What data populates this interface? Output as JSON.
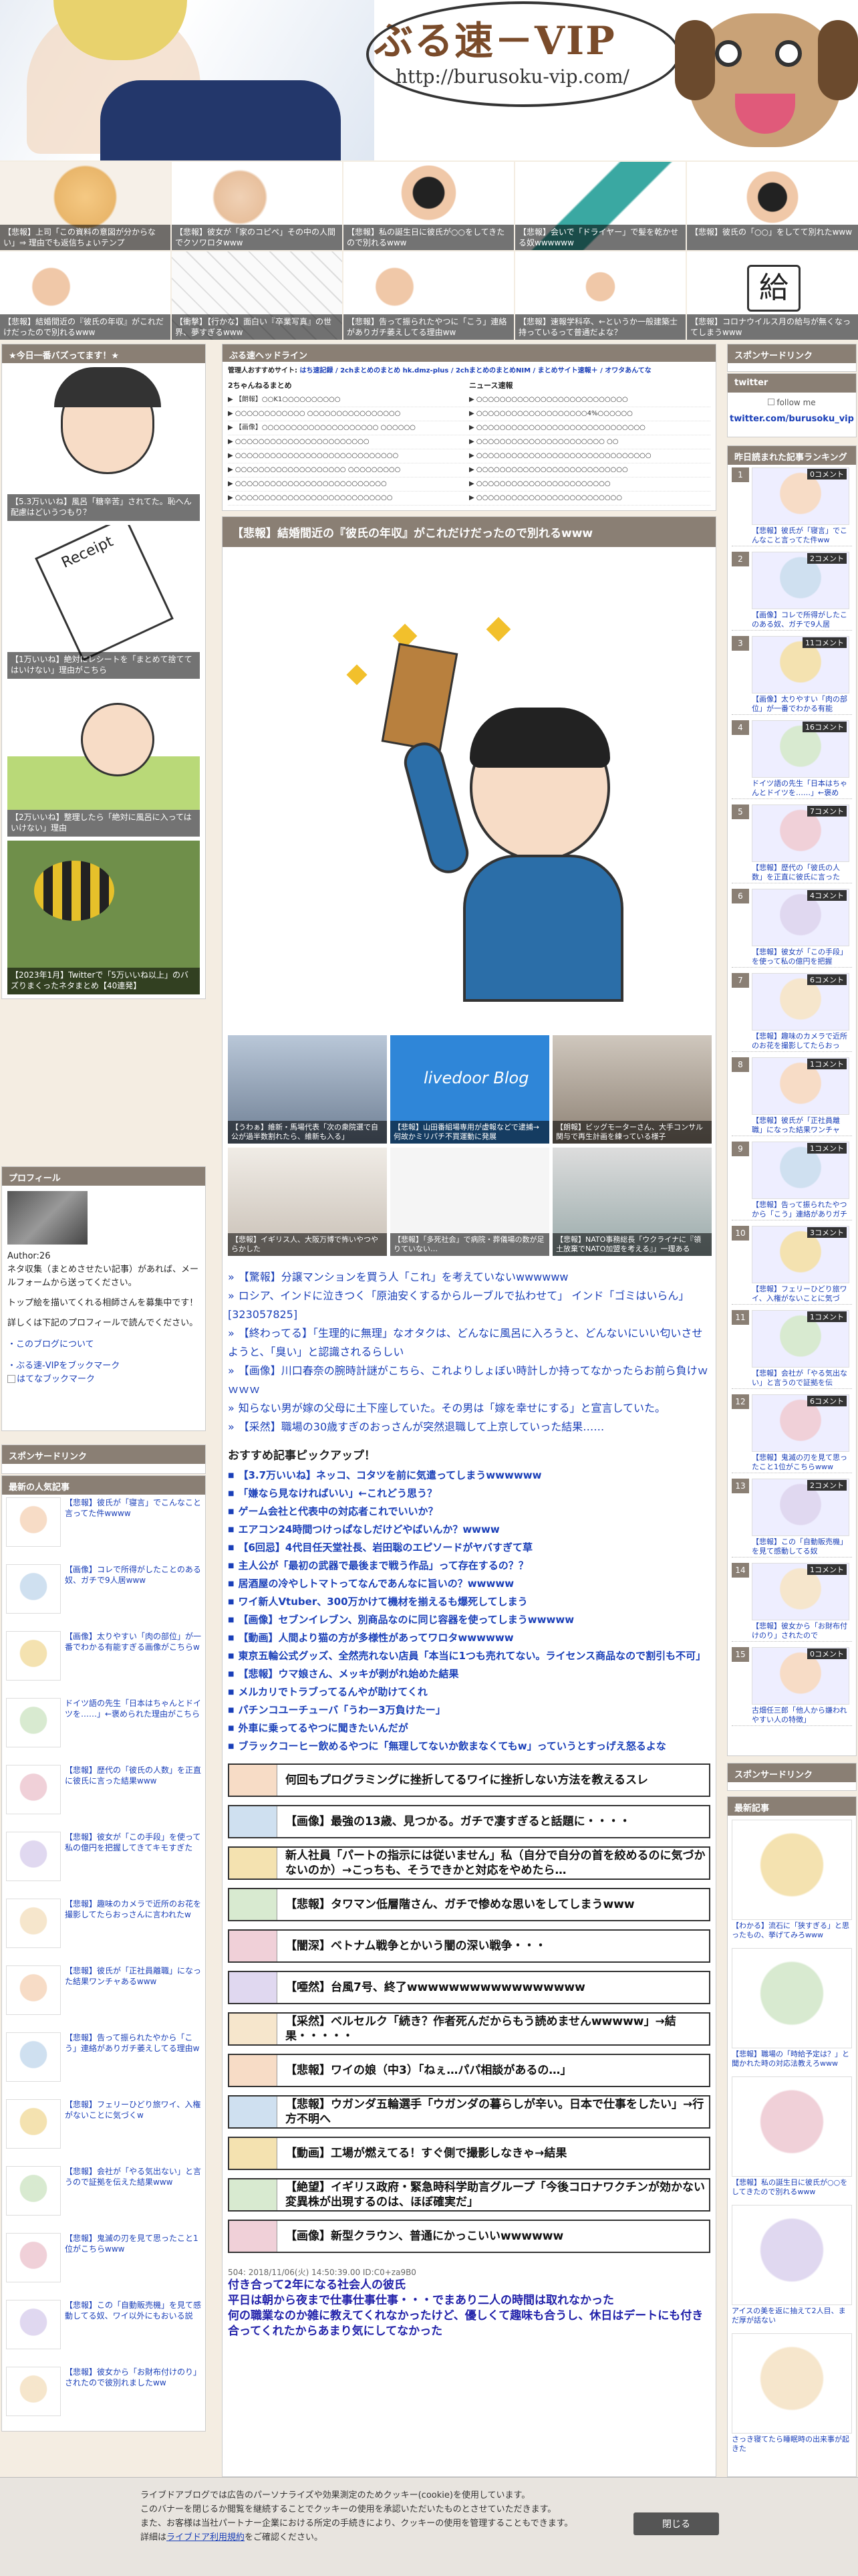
{
  "site": {
    "title": "ぶる速－VIP",
    "url": "http://burusoku-vip.com/"
  },
  "top_articles": [
    "【悲報】上司「この資料の意図が分からない」⇒ 理由でも返信ちょいテンプ",
    "【悲報】彼女が「家のコピペ」その中の人間でクソワロタwww",
    "【悲報】私の誕生日に彼氏が○○をしてきたので別れるwww",
    "【悲報】会いで「ドライヤー」で髪を乾かせる奴wwwwww",
    "【悲報】彼氏の「○○」をしてて別れたwww",
    "【悲報】結婚間近の『彼氏の年収』がこれだけだったので別れるwww",
    "【衝撃】【行かな】面白い『卒業写真』の世界、夢すぎるwww",
    "【悲報】告って振られたやつに「こう」連絡がありガチ萎えしてる理由ww",
    "【悲報】速報学科卒、←というか一般建築士持っているって普通だよな？",
    "【悲報】コロナウイルス月の給与が無くなってしまうwww"
  ],
  "left_col": {
    "head": "★今日一番バズってます！★",
    "items": [
      "【5.3万いいね】風呂「糖辛苦」されてた。恥へん配慮はどいうつもり？",
      "【1万いいね】絶対にレシートを「まとめて捨ててはいけない」理由がこちら",
      "【2万いいね】整理したら「絶対に風呂に入ってはいけない」理由",
      "【2023年1月】Twitterで「5万いいね以上」のバズりまくったネタまとめ【40連発】"
    ],
    "profile_head": "プロフィール",
    "author": "Author:26",
    "profile_text1": "ネタ収集（まとめさせたい記事）があれば、メールフォームから送ってください。",
    "profile_text2": "トップ絵を描いてくれる相師さんを募集中です！",
    "profile_text3": "詳しくは下記のプロフィールで読んでください。",
    "profile_link1": "このブログについて",
    "profile_link2": "ぶる速-VIPをブックマーク",
    "profile_link3": "はてなブックマーク",
    "sponsor_head": "スポンサードリンク",
    "popular_head": "最新の人気記事",
    "popular": [
      "【悲報】彼氏が「寝言」でこんなこと言ってた件wwww",
      "【画像】コレで所得がしたことのある奴、ガチで9人居www",
      "【画像】太りやすい「肉の部位」が一番でわかる有能すぎる画像がこちらw",
      "ドイツ語の先生「日本はちゃんとドイツを……」←褒められた理由がこちら",
      "【悲報】歴代の「彼氏の人数」を正直に彼氏に言った結果www",
      "【悲報】彼女が「この手段」を使って私の億円を把握してきてキモすぎた",
      "【悲報】趣味のカメラで近所のお花を撮影してたらおっさんに言われたw",
      "【悲報】彼氏が「正社員離職」になった結果ワンチャあるwww",
      "【悲報】告って振られたやから「こう」連絡がありガチ萎えしてる理由w",
      "【悲報】フェリーひどり旅ワイ、入権がないことに気づくw",
      "【悲報】会社が「やる気出ない」と言うので証拠を伝えた結果www",
      "【悲報】鬼滅の刃を見て思ったこと1位がこちらwww",
      "【悲報】この「自動販売機」を見て感動してる奴、ワイ以外にもおいる説",
      "【悲報】彼女から「お財布付けのり」されたので彼別れましたww"
    ]
  },
  "center": {
    "head": "ぶる速ヘッドライン",
    "antenna_label": "管理人おすすめサイト:",
    "antenna_links": "はち速記録 / 2chまとめのまとめ hk.dmz-plus / 2chまとめのまとめNIM / まとめサイト速報＋ / オワタあんてな",
    "antenna_left_title": "2ちゃんねるまとめ",
    "antenna_right_title": "ニュース速報",
    "antenna_left": [
      "▶ 【朗報】○○K1○○○○○○○○○○",
      "▶ ○○○○○○○○○○○○ ○○○○○○○○○○○○○○○○",
      "▶ 【画像】○○○○○○○○○○○○○○○○○○○○ ○○○○○○",
      "▶ ○○○○○○○○○○○○○○○○○○○○○○○",
      "▶ ○○○○○○○○○○○○○○○○○○○○○○○○○○○○",
      "▶ ○○○○○○○○○○○○○○○○○○○ ○○○○○○○○○",
      "▶ ○○○○○○○○○○○○○○○○○○○○○○○○○○",
      "▶ ○○○○○○○○○○○○○○○○○○○○○○○○○○○"
    ],
    "antenna_right": [
      "▶ ○○○○○○○○○○○○○○○○○○○○○○○○○○",
      "▶ ○○○○○○○○○○○○○○○○○○○4%○○○○○○",
      "▶ ○○○○○○○○○○○○○○○○○○○○○○○○○○○○○",
      "▶ ○○○○○○○○○○○○○○○○○○○○○○ ○○",
      "▶ ○○○○○○○○○○○○○○○○○○○○○○○○○○○○○○",
      "▶ ○○○○○○○○○○○○○○○○○○○○○○○○○○",
      "▶ ○○○○○○○○○○○○○○○○○○○○○○○",
      "▶ ○○○○○○○○○○○○○○○○○○○○○○○○○"
    ],
    "article_title": "【悲報】結婚間近の『彼氏の年収』がこれだけだったので別れるwww",
    "related": [
      "【うわぁ】維新・馬場代表「次の衆院選で自公が過半数割れたら、維新も入る」",
      "【悲報】山田番組場専用が虚報などで逮捕→何故かミリパチ不買運動に発展",
      "【朗報】ビッグモーターさん、大手コンサル関与で再生計画を練っている様子",
      "【悲報】イギリス人、大阪万博で怖いやつやらかした",
      "【悲報】「多死社会」で病院・葬儀場の数が足りていない…",
      "【悲報】NATO事務総長「ウクライナに『領土放棄でNATO加盟を考える』」一理ある"
    ],
    "main_links": [
      "【驚報】分譲マンションを買う人「これ」を考えていないwwwwww",
      "ロシア、インドに泣きつく「原油安くするからルーブルで払わせて」 インド「ゴミはいらん」[323057825]",
      "【終わってる】「生理的に無理」なオタクは、どんなに風呂に入ろうと、どんないにいい匂いさせようと、「臭い」と認識されるらしい",
      "【画像】川口春奈の腕時計謎がこちら、これよりしょぼい時計しか持ってなかったらお前ら負けｗｗｗｗ",
      "知らない男が嫁の父母に土下座していた。その男は「嫁を幸せにする」と宣言していた。",
      "【采然】職場の30歳すぎのおっさんが突然退職して上京していった結果……"
    ],
    "rec_head": "おすすめ記事ピックアップ！",
    "recommend": [
      "【3.7万いいね】ネッコ、コタツを前に気遣ってしまうwwwwww",
      "「嫌なら見なければいい」←これどう思う？",
      "ゲーム会社と代表中の対応者これでいいか？",
      "エアコン24時間つけっぱなしだけどやばいんか？wwww",
      "【6回忌】4代目任天堂社長、岩田聡のエピソードがヤバすぎて草",
      "主人公が「最初の武器で最後まで戦う作品」って存在するの？？",
      "居酒屋の冷やしトマトってなんであんなに旨いの？wwwww",
      "ワイ新人Vtuber、300万かけて機材を揃えるも爆死してしまう",
      "【画像】セブンイレブン、別商品なのに同じ容器を使ってしまうwwwww",
      "【動画】人間より猫の方が多様性があってワロタwwwwww",
      "東京五輪公式グッズ、全然売れない店員「本当に1つも売れてない。ライセンス商品なので割引も不可」",
      "【悲報】ウマ娘さん、メッキが剥がれ始めた結果",
      "メルカリでトラブってるんやが助けてくれ",
      "パチンコユーチューバ「うわー3万負けたー」",
      "外車に乗ってるやつに聞きたいんだが",
      "ブラックコーヒー飲めるやつに「無理してないか飲まなくてもw」っていうとすっげえ怒るよな"
    ],
    "big_links": [
      "何回もプログラミングに挫折してるワイに挫折しない方法を教えるスレ",
      "【画像】最強の13歳、見つかる。ガチで凄すぎると話題に・・・・",
      "新人社員「パートの指示には従いません」私（自分で自分の首を絞めるのに気づかないのか）→こっちも、そうできかと対応をやめたら…",
      "【悲報】タワマン低層階さん、ガチで惨めな思いをしてしまうwww",
      "【闇深】ベトナム戦争とかいう闇の深い戦争・・・",
      "【唖然】台風7号、終了wwwwwwwwwwwwwwwww",
      "【采然】ベルセルク「続き？作者死んだからもう読めませんwwwww」→結果・・・・・",
      "【悲報】ワイの娘（中3）「ねぇ…パパ相談があるの…」",
      "【悲報】ウガンダ五輪選手「ウガンダの暮らしが辛い。日本で仕事をしたい」→行方不明へ",
      "【動画】工場が燃えてる！すぐ側で撮影しなきゃ→結果",
      "【絶望】イギリス政府・緊急時科学助言グループ「今後コロナワクチンが効かない変異株が出現するのは、ほぼ確実だ」",
      "【画像】新型クラウン、普通にかっこいいwwwwww"
    ],
    "comment_meta": "504: 2018/11/06(火) 14:50:39.00 ID:C0+za9B0",
    "comment_body": "付き合って2年になる社会人の彼氏\n平日は朝から夜まで仕事仕事仕事・・・でまあり二人の時間は取れなかった\n何の職業なのか雑に教えてくれなかったけど、優しくて趣味も合うし、休日はデートにも付き合ってくれたからあまり気にしてなかった"
  },
  "right_col": {
    "sponsor_head": "スポンサードリンク",
    "twitter_head": "twitter",
    "follow_alt": "follow me",
    "twitter_handle": "twitter.com/burusoku_vip",
    "ranking_head": "昨日読まれた記事ランキング",
    "ranking": [
      {
        "n": "1",
        "c": "0コメント",
        "t": "【悲報】彼氏が「寝言」でこんなこと言ってた件ww"
      },
      {
        "n": "2",
        "c": "2コメント",
        "t": "【画像】コレで所得がしたこのある奴、ガチで9人居"
      },
      {
        "n": "3",
        "c": "11コメント",
        "t": "【画像】太りやすい「肉の部位」が一番でわかる有能"
      },
      {
        "n": "4",
        "c": "16コメント",
        "t": "ドイツ語の先生「日本はちゃんとドイツを……」←褒め"
      },
      {
        "n": "5",
        "c": "7コメント",
        "t": "【悲報】歴代の「彼氏の人数」を正直に彼氏に言った"
      },
      {
        "n": "6",
        "c": "4コメント",
        "t": "【悲報】彼女が「この手段」を使って私の億円を把握"
      },
      {
        "n": "7",
        "c": "6コメント",
        "t": "【悲報】趣味のカメラで近所のお花を撮影してたらおっ"
      },
      {
        "n": "8",
        "c": "1コメント",
        "t": "【悲報】彼氏が「正社員離職」になった結果ワンチャ"
      },
      {
        "n": "9",
        "c": "1コメント",
        "t": "【悲報】告って振られたやつから「こう」連絡がありガチ"
      },
      {
        "n": "10",
        "c": "3コメント",
        "t": "【悲報】フェリーひどり旅ワイ、入権がないことに気づ"
      },
      {
        "n": "11",
        "c": "1コメント",
        "t": "【悲報】会社が「やる気出ない」と言うので証拠を伝"
      },
      {
        "n": "12",
        "c": "6コメント",
        "t": "【悲報】鬼滅の刃を見て思ったこと1位がこちらwww"
      },
      {
        "n": "13",
        "c": "2コメント",
        "t": "【悲報】この「自動販売機」を見て感動してる奴"
      },
      {
        "n": "14",
        "c": "1コメント",
        "t": "【悲報】彼女から「お財布付けのり」されたので"
      },
      {
        "n": "15",
        "c": "0コメント",
        "t": "古畑任三郎「他人から嫌われやすい人の特徴」"
      }
    ],
    "sponsor_head2": "スポンサードリンク",
    "new_head": "最新記事",
    "new_items": [
      "【わかる】流石に「狭すぎる」と思ったもの、挙げてみろwww",
      "【悲報】職場の「時給予定は？」と聞かれた時の対応法教えろwww",
      "【悲報】私の誕生日に彼氏が○○をしてきたので別れるwww",
      "アイスの美を返に抽えて2人目、まだ厚が話ない",
      "さっき寝てたら睡眠時の出来事が起きた"
    ]
  },
  "cookie": {
    "line1": "ライブドアブログでは広告のパーソナライズや効果測定のためクッキー(cookie)を使用しています。",
    "line2": "このバナーを閉じるか閲覧を継続することでクッキーの使用を承認いただいたものとさせていただきます。",
    "line3": "また、お客様は当社パートナー企業における所定の手続きにより、クッキーの使用を管理することもできます。",
    "line4_pre": "詳細は",
    "line4_link": "ライブドア利用規約",
    "line4_post": "をご確認ください。",
    "close_btn": "閉じる"
  }
}
